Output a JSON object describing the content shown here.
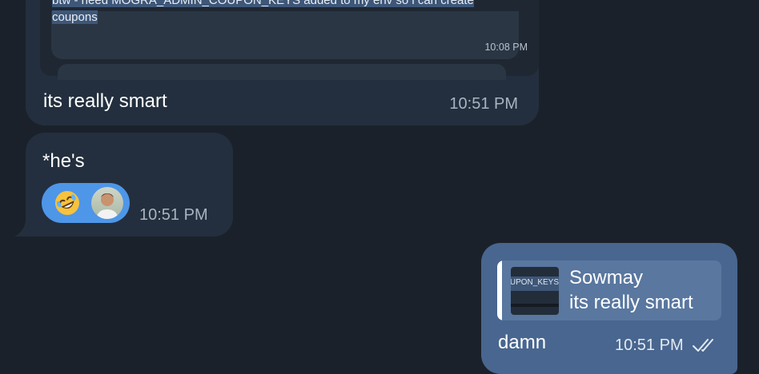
{
  "messages": [
    {
      "quote": {
        "text": "btw - need MOGRA_ADMIN_COUPON_KEYS added to my env so i can create coupons",
        "time": "10:08 PM"
      },
      "text": "its really smart",
      "time": "10:51 PM"
    },
    {
      "text": "*he's",
      "reaction_emoji": "rolling-on-floor-laughing-emoji",
      "time": "10:51 PM"
    },
    {
      "reply": {
        "thumb_text": "UPON_KEYS",
        "name": "Sowmay",
        "text": "its really smart"
      },
      "text": "damn",
      "time": "10:51 PM",
      "status_icon": "double-check-icon"
    }
  ],
  "colors": {
    "background": "#1b212a",
    "incoming_bubble": "#232f3e",
    "outgoing_bubble": "#48668f",
    "reaction_pill": "#4e96e8"
  }
}
